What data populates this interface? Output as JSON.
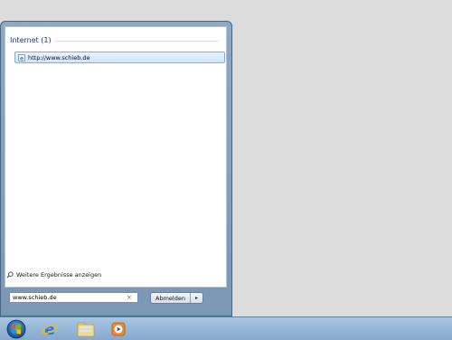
{
  "start_menu": {
    "group_header": "Internet (1)",
    "result_url": "http://www.schieb.de",
    "more_results": "Weitere Ergebnisse anzeigen",
    "search_value": "www.schieb.de",
    "clear_glyph": "×",
    "shutdown_label": "Abmelden",
    "shutdown_arrow": "▸"
  },
  "taskbar": {
    "items": [
      {
        "icon": "windows-start-orb"
      },
      {
        "icon": "internet-explorer"
      },
      {
        "icon": "windows-explorer-folder"
      },
      {
        "icon": "media-player"
      }
    ]
  }
}
